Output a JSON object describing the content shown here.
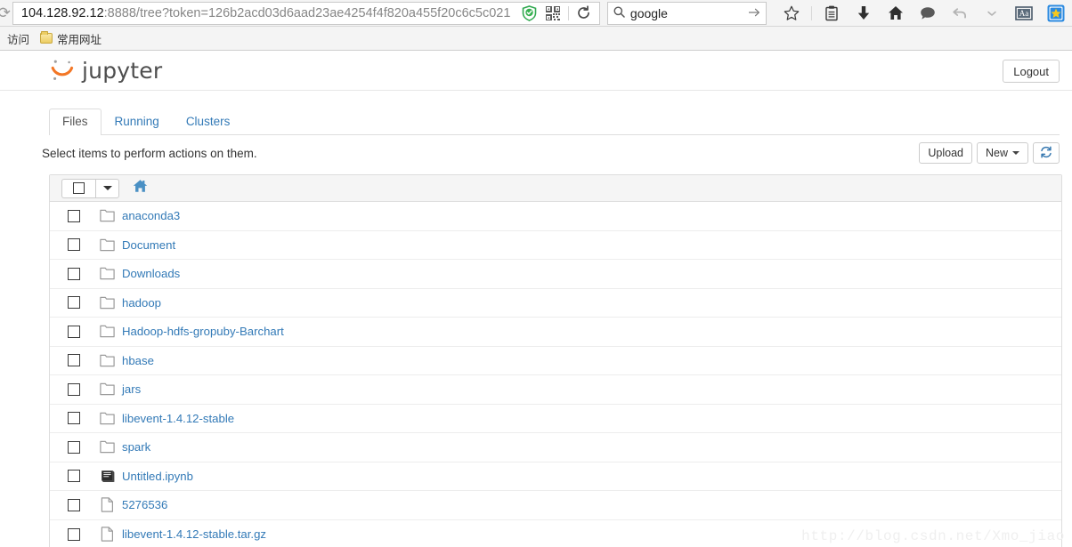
{
  "browser": {
    "url": {
      "host": "104.128.92.12",
      "rest": ":8888/tree?token=126b2acd03d6aad23ae4254f4f820a455f20c6c5c021",
      "full": "104.128.92.12:8888/tree?token=126b2acd03d6aad23ae4254f4f820a455f20c6c5c021"
    },
    "search": {
      "value": "google",
      "icon": "search-icon",
      "go_icon": "arrow-right-icon"
    },
    "chrome_icons": [
      "shield-check-icon",
      "qr-code-icon",
      "reload-icon"
    ],
    "toolbar_icons": [
      "star-icon",
      "clipboard-icon",
      "download-arrow-icon",
      "home-icon",
      "comment-bubble-icon",
      "undo-arrow-icon",
      "chevron-down-icon",
      "font-size-aa-icon",
      "favorites-star-badge-icon"
    ],
    "bookmarks": {
      "label": "访问",
      "items": [
        {
          "label": "常用网址",
          "icon": "folder-icon"
        }
      ]
    }
  },
  "jupyter": {
    "brand": "jupyter",
    "logo_icon": "jupyter-logo-icon",
    "logout_label": "Logout",
    "tabs": [
      {
        "label": "Files",
        "active": true
      },
      {
        "label": "Running",
        "active": false
      },
      {
        "label": "Clusters",
        "active": false
      }
    ],
    "toolbar": {
      "select_hint": "Select items to perform actions on them.",
      "upload_label": "Upload",
      "new_label": "New",
      "refresh_icon": "refresh-icon"
    },
    "list_header": {
      "select_all_icon": "checkbox-icon",
      "select_all_caret_icon": "chevron-down-icon",
      "breadcrumb_home_icon": "home-icon"
    },
    "files": [
      {
        "name": "anaconda3",
        "type": "folder"
      },
      {
        "name": "Document",
        "type": "folder"
      },
      {
        "name": "Downloads",
        "type": "folder"
      },
      {
        "name": "hadoop",
        "type": "folder"
      },
      {
        "name": "Hadoop-hdfs-gropuby-Barchart",
        "type": "folder"
      },
      {
        "name": "hbase",
        "type": "folder"
      },
      {
        "name": "jars",
        "type": "folder"
      },
      {
        "name": "libevent-1.4.12-stable",
        "type": "folder"
      },
      {
        "name": "spark",
        "type": "folder"
      },
      {
        "name": "Untitled.ipynb",
        "type": "notebook"
      },
      {
        "name": "5276536",
        "type": "file"
      },
      {
        "name": "libevent-1.4.12-stable.tar.gz",
        "type": "file"
      }
    ]
  },
  "watermark": "http://blog.csdn.net/Xmo_jiao",
  "colors": {
    "link": "#337ab7",
    "jupyter_orange": "#f37726",
    "border": "#dddddd",
    "header_bg": "#f5f5f5"
  }
}
